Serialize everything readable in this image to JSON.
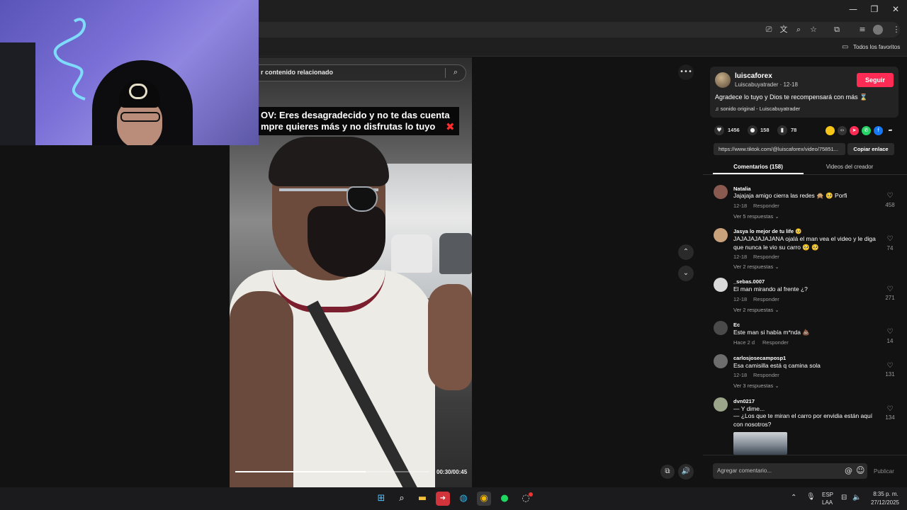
{
  "browser": {
    "window_controls": {
      "minimize": "—",
      "restore": "❐",
      "close": "✕"
    },
    "bookmarks_label": "Todos los favoritos"
  },
  "video": {
    "search_placeholder": "r contenido relacionado",
    "caption_line1": "OV: Eres desagradecido y no te das cuenta",
    "caption_line2": "mpre quieres más y no disfrutas lo tuyo",
    "caption_emoji": "✖",
    "time": "00:30/00:45",
    "progress": 0.67
  },
  "author": {
    "name": "luiscaforex",
    "meta": "Luiscabuyatrader · 12-18",
    "follow_label": "Seguir",
    "description": "Agradece lo tuyo y Dios te recompensará con más ⌛",
    "music": "♫  sonido original - Luiscabuyatrader"
  },
  "stats": {
    "likes": "1456",
    "comments": "158",
    "saves": "78"
  },
  "share": {
    "link": "https://www.tiktok.com/@luiscaforex/video/75851...",
    "copy_label": "Copiar enlace"
  },
  "tabs": {
    "comments": "Comentarios (158)",
    "creator_videos": "Videos del creador"
  },
  "comments": [
    {
      "user": "Natalia",
      "text": "Jajajaja amigo cierra las redes 🙊 🥺 Porfi",
      "date": "12-18",
      "reply": "Responder",
      "replies": "Ver 5 respuestas ⌄",
      "likes": "458"
    },
    {
      "user": "Jasya lo mejor de tu life 🥺",
      "text": "JAJAJAJAJAJANA ojalá el man vea el video y le diga",
      "text2": "que nunca le vio su carro 🥺 🥺",
      "date": "12-18",
      "reply": "Responder",
      "replies": "Ver 2 respuestas ⌄",
      "likes": "74"
    },
    {
      "user": "_sebas.0007",
      "text": "El man mirando al frente ¿?",
      "date": "12-18",
      "reply": "Responder",
      "replies": "Ver 2 respuestas ⌄",
      "likes": "271"
    },
    {
      "user": "Ec",
      "text": "Este man si había m*nda 💩",
      "date": "Hace 2 d",
      "reply": "Responder",
      "likes": "14"
    },
    {
      "user": "carlosjosecamposp1",
      "text": "Esa camisilla está q camina sola",
      "date": "12-18",
      "reply": "Responder",
      "replies": "Ver 3 respuestas ⌄",
      "likes": "131"
    },
    {
      "user": "dvn0217",
      "text": "— Y dime...",
      "text2": "— ¿Los que te miran el carro por envidia están aquí",
      "text3": "con nosotros?",
      "likes": "134"
    }
  ],
  "comment_bar": {
    "placeholder": "Agregar comentario...",
    "publish": "Publicar"
  },
  "taskbar": {
    "language": "ESP",
    "language2": "LAA",
    "time": "8:35 p. m.",
    "date": "27/12/2025"
  }
}
